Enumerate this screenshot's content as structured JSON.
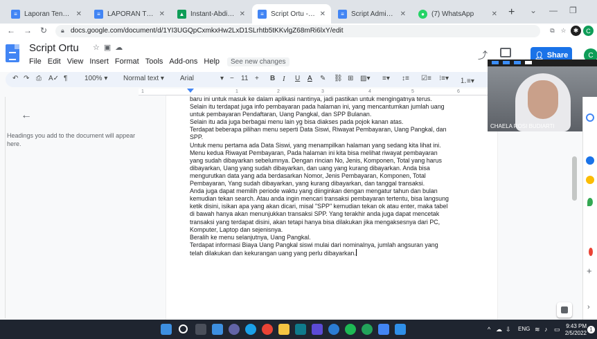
{
  "browser": {
    "tabs": [
      {
        "title": "Laporan Tengah - A",
        "favicon": "google-docs-icon",
        "color": "#4285f4"
      },
      {
        "title": "LAPORAN TENGAH",
        "favicon": "google-docs-icon",
        "color": "#4285f4"
      },
      {
        "title": "Instant-Abdimas",
        "favicon": "google-drive-icon",
        "color": "#0f9d58"
      },
      {
        "title": "Script Ortu - Googl",
        "favicon": "google-docs-icon",
        "color": "#4285f4",
        "active": true
      },
      {
        "title": "Script Admin - Goo",
        "favicon": "google-docs-icon",
        "color": "#4285f4"
      },
      {
        "title": "(7) WhatsApp",
        "favicon": "whatsapp-icon",
        "color": "#25d366"
      }
    ],
    "url": "docs.google.com/document/d/1YI3UGQpCxmkxHw2LxD1SLrhtb5tKKvlgZ68mRi6lxY/edit"
  },
  "doc": {
    "title": "Script Ortu",
    "menu": [
      "File",
      "Edit",
      "View",
      "Insert",
      "Format",
      "Tools",
      "Add-ons",
      "Help"
    ],
    "last_edit": "See new changes",
    "share_label": "Share",
    "avatar_letter": "C",
    "toolbar": {
      "zoom": "100%",
      "style": "Normal text",
      "font": "Arial",
      "font_size": "11"
    },
    "outline_hint": "Headings you add to the document will appear here.",
    "lines": [
      "baru ini untuk masuk ke dalam aplikasi nantinya, jadi pastikan untuk mengingatnya terus.",
      "Selain itu terdapat juga info pembayaran pada halaman ini, yang mencantumkan jumlah uang",
      "untuk pembayaran Pendaftaran, Uang Pangkal, dan SPP Bulanan.",
      "Selain itu ada juga berbagai menu lain yg bisa diakses pada pojok kanan atas.",
      "Terdapat beberapa pilihan menu seperti Data Siswi, Riwayat Pembayaran, Uang Pangkal, dan",
      "SPP.",
      "Untuk menu pertama ada Data Siswi, yang menampilkan halaman yang sedang kita lihat ini.",
      "Menu kedua Riwayat Pembayaran, Pada halaman ini kita bisa melihat riwayat pembayaran",
      "yang sudah dibayarkan sebelumnya. Dengan rincian No, Jenis, Komponen, Total yang harus",
      "dibayarkan, Uang yang sudah dibayarkan, dan uang yang kurang dibayarkan. Anda bisa",
      "mengurutkan data yang ada berdasarkan Nomor, Jenis Pembayaran, Komponen, Total",
      "Pembayaran, Yang sudah dibayarkan, yang kurang dibayarkan, dan tanggal transaksi.",
      "Anda juga dapat memilih periode waktu yang diinginkan dengan mengatur tahun dan bulan",
      "kemudian tekan search. Atau anda ingin mencari transaksi pembayaran tertentu, bisa langsung",
      "ketik disini, isikan apa yang akan dicari, misal \"SPP\" kemudian tekan ok atau enter, maka tabel",
      "di bawah hanya akan menunjukkan transaksi SPP. Yang terakhir anda juga dapat mencetak",
      "transaksi yang terdapat disini, akan tetapi hanya bisa dilakukan jika mengaksesnya dari PC,",
      "Komputer, Laptop dan sejenisnya.",
      "Beralih ke menu selanjutnya, Uang Pangkal.",
      "Terdapat informasi Biaya Uang Pangkal siswi mulai dari nominalnya, jumlah angsuran yang",
      "telah dilakukan dan kekurangan uang yang perlu dibayarkan."
    ]
  },
  "webcam": {
    "name": "CHAELA ROSI BUDIARTI"
  },
  "taskbar": {
    "language": "ENG",
    "time": "9:43 PM",
    "date": "2/5/2022",
    "notifications": "1"
  }
}
